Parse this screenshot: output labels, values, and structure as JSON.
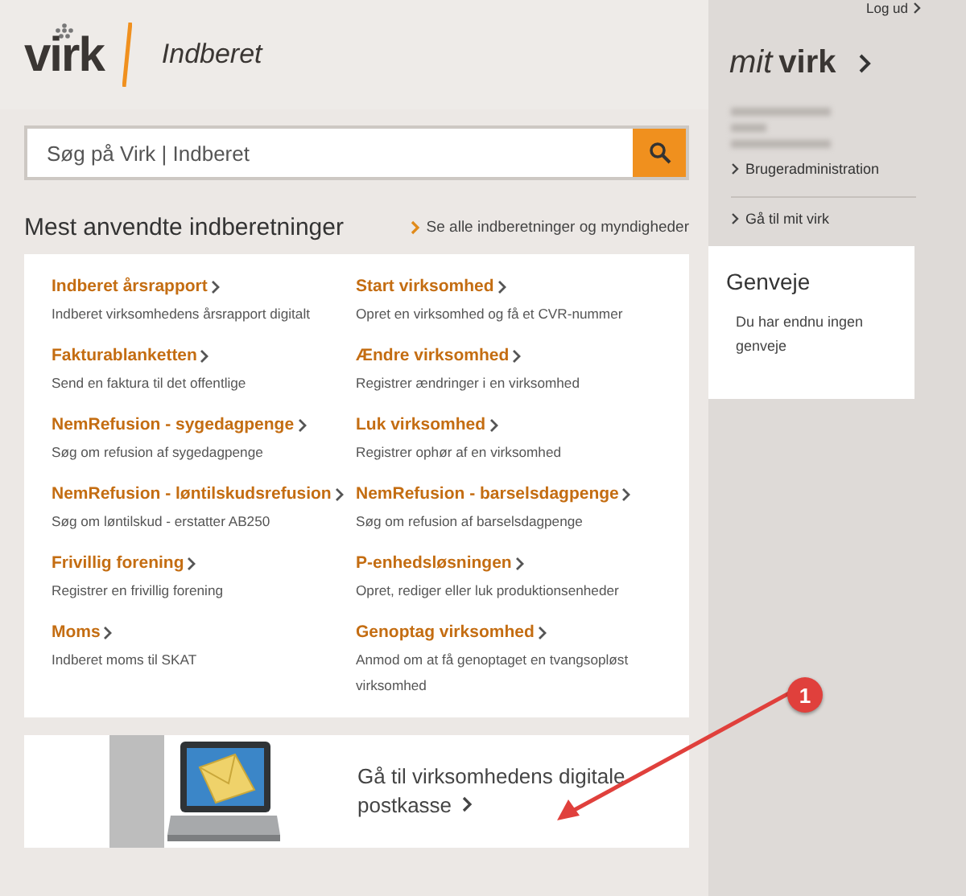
{
  "header": {
    "logo": "virk",
    "section": "Indberet"
  },
  "search": {
    "placeholder": "Søg på Virk | Indberet"
  },
  "most_used": {
    "title": "Mest anvendte indberetninger",
    "see_all": "Se alle indberetninger og myndigheder",
    "items": [
      {
        "title": "Indberet årsrapport",
        "description": "Indberet virksomhedens årsrapport digitalt"
      },
      {
        "title": "Start virksomhed",
        "description": "Opret en virksomhed og få et CVR-nummer"
      },
      {
        "title": "Fakturablanketten",
        "description": "Send en faktura til det offentlige"
      },
      {
        "title": "Ændre virksomhed",
        "description": "Registrer ændringer i en virksomhed"
      },
      {
        "title": "NemRefusion - sygedagpenge",
        "description": "Søg om refusion af sygedagpenge"
      },
      {
        "title": "Luk virksomhed",
        "description": "Registrer ophør af en virksomhed"
      },
      {
        "title": "NemRefusion - løntilskudsrefusion",
        "description": "Søg om løntilskud - erstatter AB250"
      },
      {
        "title": "NemRefusion - barselsdagpenge",
        "description": "Søg om refusion af barselsdagpenge"
      },
      {
        "title": "Frivillig forening",
        "description": "Registrer en frivillig forening"
      },
      {
        "title": "P-enhedsløsningen",
        "description": "Opret, rediger eller luk produktionsenheder"
      },
      {
        "title": "Moms",
        "description": "Indberet moms til SKAT"
      },
      {
        "title": "Genoptag virksomhed",
        "description": "Anmod om at få genoptaget en tvangsopløst virksomhed"
      }
    ]
  },
  "digital_post": {
    "link": "Gå til virksomhedens digitale postkasse"
  },
  "sidebar": {
    "logout": "Log ud",
    "mit_virk": {
      "prefix": "mit",
      "logo": "virk"
    },
    "links": [
      "Brugeradministration",
      "Gå til mit virk"
    ],
    "shortcuts": {
      "title": "Genveje",
      "empty": "Du har endnu ingen genveje"
    }
  },
  "annotation": {
    "number": "1"
  }
}
